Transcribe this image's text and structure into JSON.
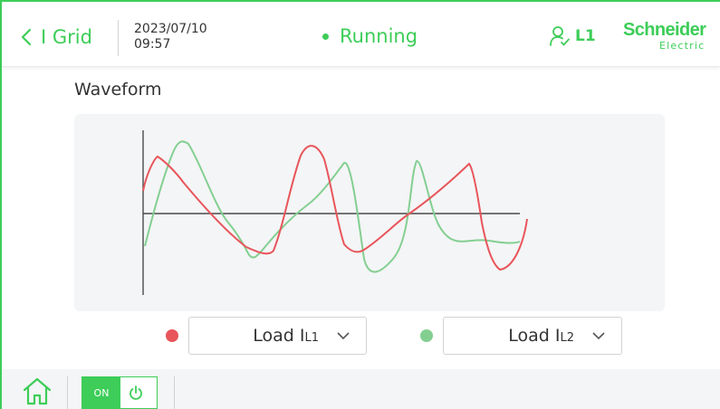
{
  "header": {
    "back_label": "I Grid",
    "date": "2023/07/10",
    "time": "09:57",
    "status": "Running",
    "user_level": "L1",
    "logo_main": "Schneider",
    "logo_sub": "Electric"
  },
  "section_title": "Waveform",
  "chart_data": {
    "type": "line",
    "series": [
      {
        "color": "#e8555b"
      },
      {
        "color": "#83cf91"
      }
    ]
  },
  "selectors": [
    {
      "color": "#e8555b",
      "label": "Load I",
      "sub": "L1"
    },
    {
      "color": "#83cf91",
      "label": "Load I",
      "sub": "L2"
    }
  ],
  "footer": {
    "toggle_label": "ON"
  },
  "colors": {
    "accent": "#3dcd58",
    "series_1": "#e8555b",
    "series_2": "#83cf91"
  },
  "icons": [
    "chevron-left-icon",
    "user-icon",
    "home-icon",
    "power-icon",
    "chevron-down-icon"
  ]
}
